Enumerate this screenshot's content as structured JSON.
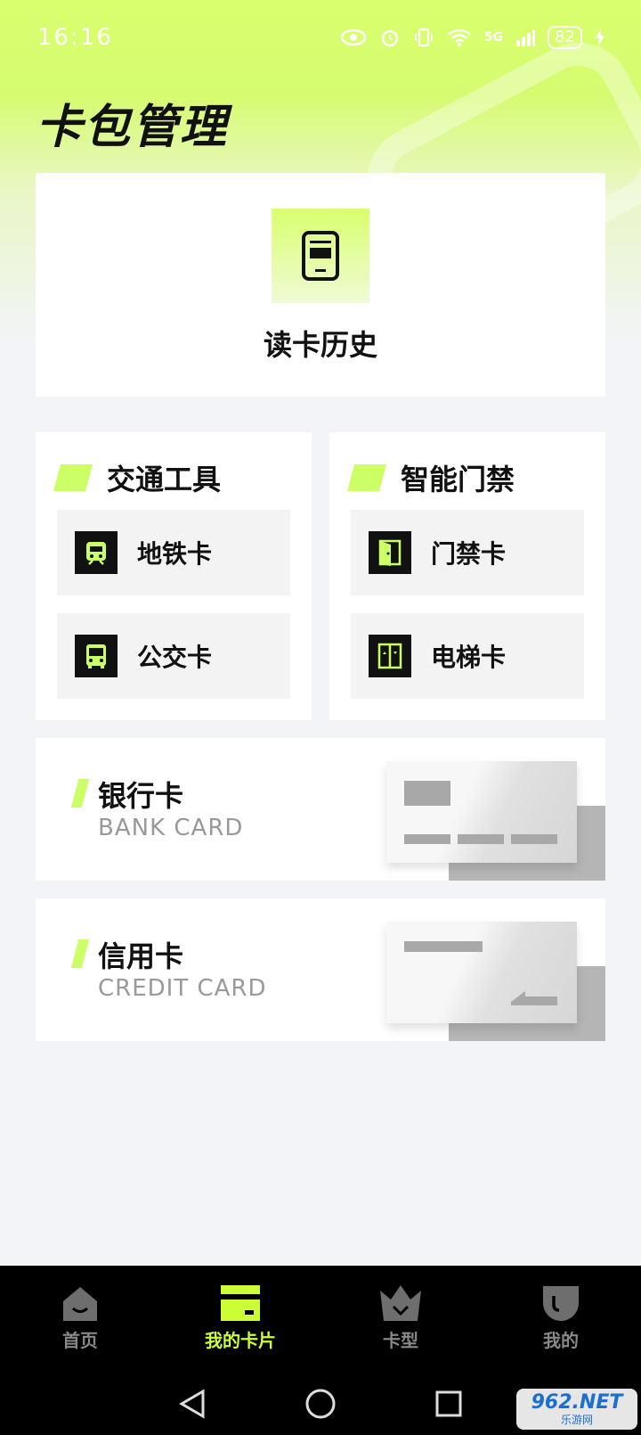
{
  "status_bar": {
    "time": "16:16",
    "network": "5G",
    "battery": "82"
  },
  "page_title": "卡包管理",
  "history": {
    "label": "读卡历史"
  },
  "groups": [
    {
      "title": "交通工具",
      "items": [
        {
          "label": "地铁卡",
          "icon": "metro-icon"
        },
        {
          "label": "公交卡",
          "icon": "bus-icon"
        }
      ]
    },
    {
      "title": "智能门禁",
      "items": [
        {
          "label": "门禁卡",
          "icon": "door-icon"
        },
        {
          "label": "电梯卡",
          "icon": "elevator-icon"
        }
      ]
    }
  ],
  "bank_cards": [
    {
      "title": "银行卡",
      "subtitle": "BANK CARD"
    },
    {
      "title": "信用卡",
      "subtitle": "CREDIT CARD"
    }
  ],
  "tabs": [
    {
      "label": "首页",
      "icon": "home-icon",
      "active": false
    },
    {
      "label": "我的卡片",
      "icon": "card-icon",
      "active": true
    },
    {
      "label": "卡型",
      "icon": "crown-icon",
      "active": false
    },
    {
      "label": "我的",
      "icon": "profile-icon",
      "active": false
    }
  ],
  "watermark": {
    "main": "962.NET",
    "sub": "乐游网"
  },
  "colors": {
    "accent": "#ccff33",
    "hero": "#d9ff6e",
    "tab_bg": "#000000",
    "inactive": "#888888"
  }
}
